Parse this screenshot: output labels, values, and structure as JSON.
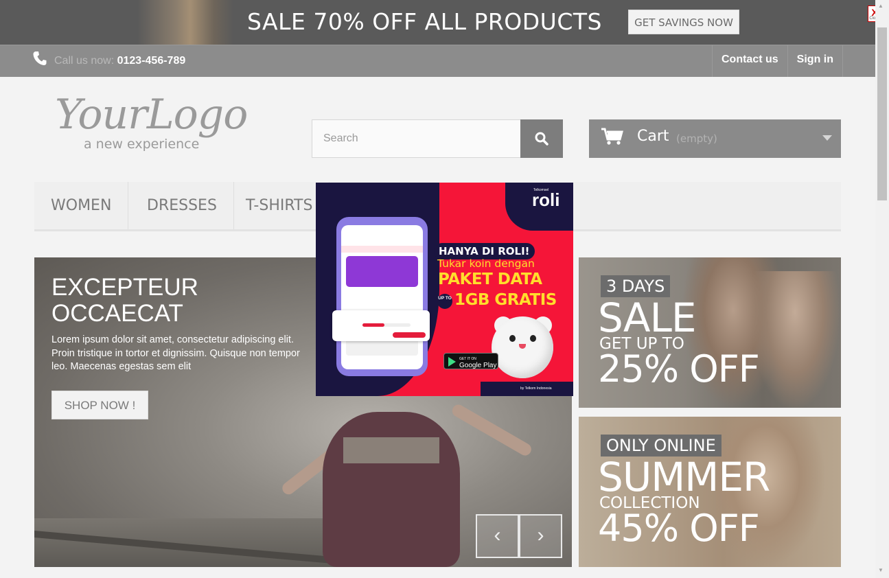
{
  "promo_bar": {
    "text": "SALE 70% OFF ALL PRODUCTS",
    "button": "GET SAVINGS NOW",
    "close_label": "X",
    "close_caption": "Close"
  },
  "nav": {
    "call_prefix": "Call us now:",
    "phone": "0123-456-789",
    "contact": "Contact us",
    "signin": "Sign in"
  },
  "logo": {
    "name": "YourLogo",
    "tagline": "a new experience"
  },
  "search": {
    "placeholder": "Search"
  },
  "cart": {
    "label": "Cart",
    "status": "(empty)"
  },
  "menu": {
    "items": [
      "WOMEN",
      "DRESSES",
      "T-SHIRTS"
    ]
  },
  "slider": {
    "title": "EXCEPTEUR OCCAECAT",
    "text": "Lorem ipsum dolor sit amet, consectetur adipiscing elit. Proin tristique in tortor et dignissim. Quisque non tempor leo. Maecenas egestas sem elit",
    "button": "SHOP NOW !",
    "prev": "‹",
    "next": "›"
  },
  "banners": [
    {
      "tag": "3 DAYS",
      "big": "SALE",
      "mid": "GET UP TO",
      "pct": "25% OFF"
    },
    {
      "tag": "ONLY ONLINE",
      "big": "SUMMER",
      "mid": "COLLECTION",
      "pct": "45% OFF"
    }
  ],
  "popup": {
    "brand_small": "Telkomsel",
    "brand": "roli",
    "headline": "HANYA DI ROLI!",
    "line2": "Tukar koin dengan",
    "line3": "PAKET DATA",
    "upto": "UP TO",
    "line4": "1GB GRATIS",
    "store_small": "GET IT ON",
    "store": "Google Play",
    "footer": "by Telkom Indonesia"
  },
  "colors": {
    "topbar": "#5a5a5a",
    "navbar": "#8c8c8c",
    "popup_red": "#f51538",
    "popup_navy": "#1a1540",
    "popup_yellow": "#ffde2c"
  },
  "icons": [
    "phone-icon",
    "search-icon",
    "cart-icon",
    "chevron-down-icon",
    "chevron-left-icon",
    "chevron-right-icon",
    "close-icon"
  ]
}
